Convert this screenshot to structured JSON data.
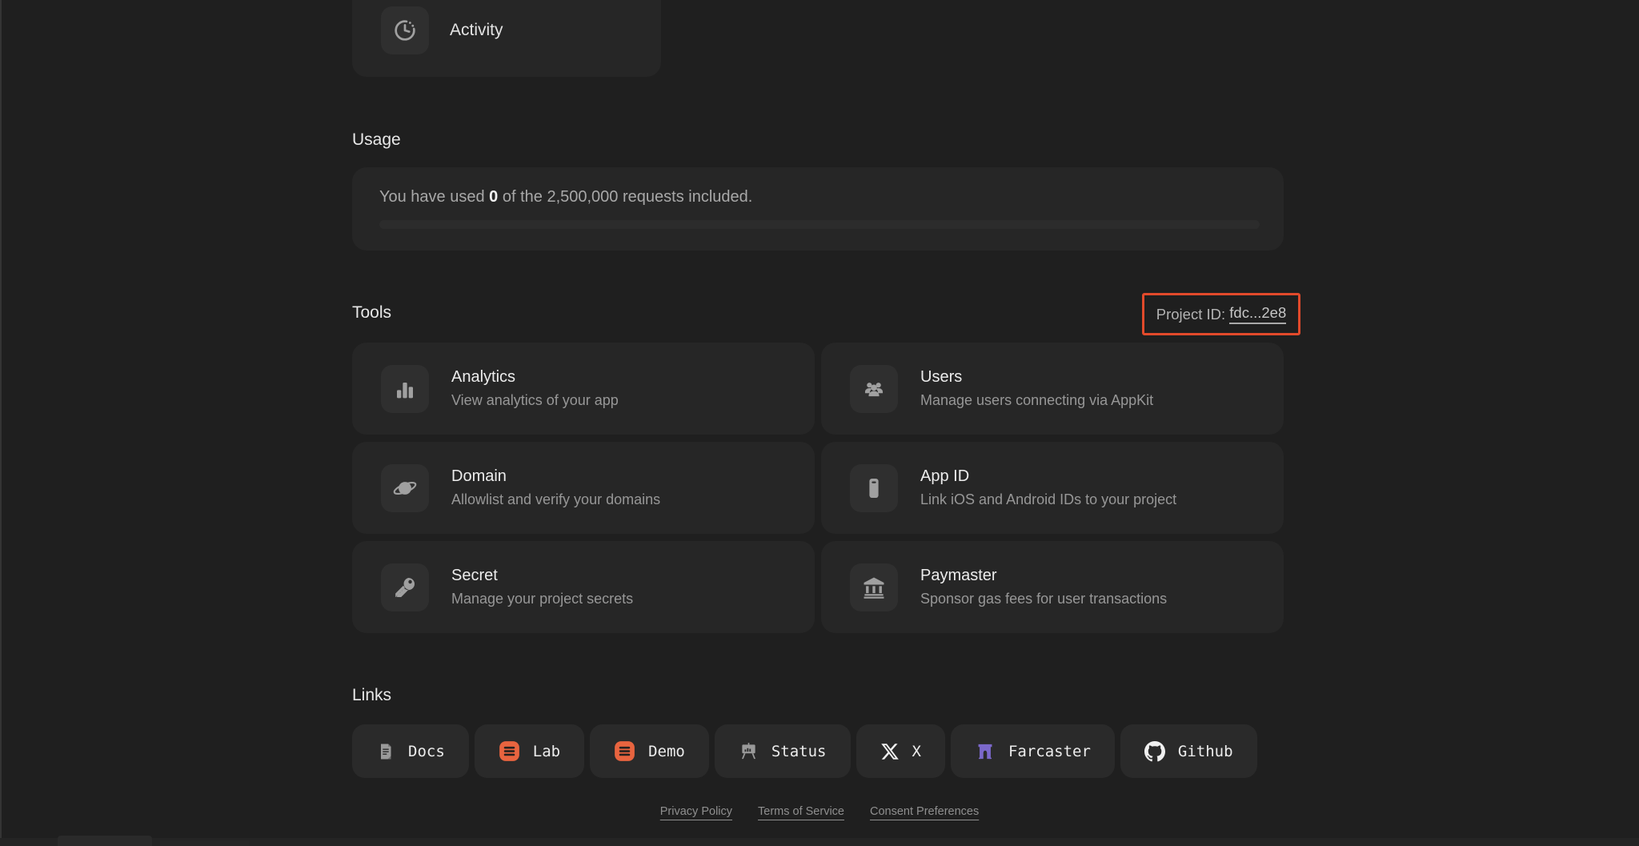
{
  "page": {
    "background": "#1f1f1f"
  },
  "activity_card": {
    "label": "Activity",
    "icon": "clock-history-icon"
  },
  "usage": {
    "heading": "Usage",
    "text_prefix": "You have used ",
    "used_count": "0",
    "text_suffix": " of the 2,500,000 requests included.",
    "progress_percent": 0
  },
  "tools": {
    "heading": "Tools",
    "project_id": {
      "label": "Project ID: ",
      "value": "fdc...2e8",
      "highlight_color": "#e24a2b"
    },
    "cards": [
      {
        "title": "Analytics",
        "description": "View analytics of your app",
        "icon": "bar-chart-icon"
      },
      {
        "title": "Users",
        "description": "Manage users connecting via AppKit",
        "icon": "users-icon"
      },
      {
        "title": "Domain",
        "description": "Allowlist and verify your domains",
        "icon": "planet-icon"
      },
      {
        "title": "App ID",
        "description": "Link iOS and Android IDs to your project",
        "icon": "phone-icon"
      },
      {
        "title": "Secret",
        "description": "Manage your project secrets",
        "icon": "key-icon"
      },
      {
        "title": "Paymaster",
        "description": "Sponsor gas fees for user transactions",
        "icon": "bank-icon"
      }
    ]
  },
  "links": {
    "heading": "Links",
    "items": [
      {
        "label": "Docs",
        "icon": "docs-icon"
      },
      {
        "label": "Lab",
        "icon": "lab-icon",
        "icon_color": "#e8643f"
      },
      {
        "label": "Demo",
        "icon": "demo-icon",
        "icon_color": "#e8643f"
      },
      {
        "label": "Status",
        "icon": "status-icon"
      },
      {
        "label": "X",
        "icon": "x-logo-icon"
      },
      {
        "label": "Farcaster",
        "icon": "farcaster-icon",
        "icon_color": "#7b68ca"
      },
      {
        "label": "Github",
        "icon": "github-icon"
      }
    ]
  },
  "footer": {
    "links": [
      "Privacy Policy",
      "Terms of Service",
      "Consent Preferences"
    ]
  }
}
